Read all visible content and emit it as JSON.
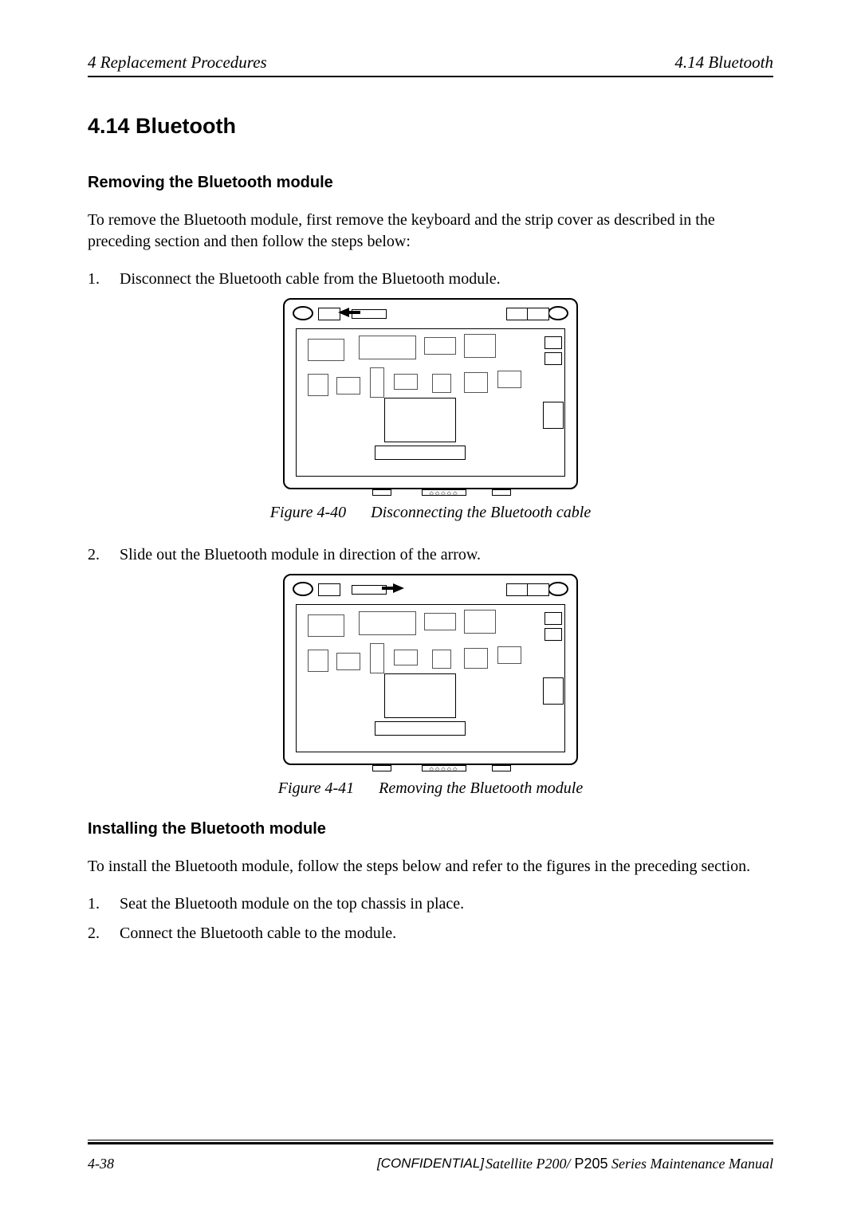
{
  "header": {
    "left": "4  Replacement Procedures",
    "right": "4.14  Bluetooth"
  },
  "section_title": "4.14  Bluetooth",
  "removing": {
    "heading": "Removing the Bluetooth module",
    "intro": "To remove the Bluetooth module, first remove the keyboard and the strip cover as described in the preceding section and then follow the steps below:",
    "steps": [
      {
        "num": "1.",
        "text": "Disconnect the Bluetooth cable from the Bluetooth module."
      },
      {
        "num": "2.",
        "text": "Slide out the Bluetooth module in direction of the arrow."
      }
    ]
  },
  "figures": {
    "f40": {
      "label": "Figure 4-40",
      "caption": "Disconnecting the Bluetooth cable"
    },
    "f41": {
      "label": "Figure 4-41",
      "caption": "Removing the Bluetooth module"
    }
  },
  "installing": {
    "heading": "Installing the Bluetooth module",
    "intro": "To install the Bluetooth module, follow the steps below and refer to the figures in the preceding section.",
    "steps": [
      {
        "num": "1.",
        "text": "Seat the Bluetooth module on the top chassis in place."
      },
      {
        "num": "2.",
        "text": "Connect the Bluetooth cable to the module."
      }
    ]
  },
  "footer": {
    "page_num": "4-38",
    "confidential": "[CONFIDENTIAL]",
    "manual_prefix": "Satellite P200/",
    "manual_mid": " P205",
    "manual_suffix": " Series Maintenance Manual"
  }
}
